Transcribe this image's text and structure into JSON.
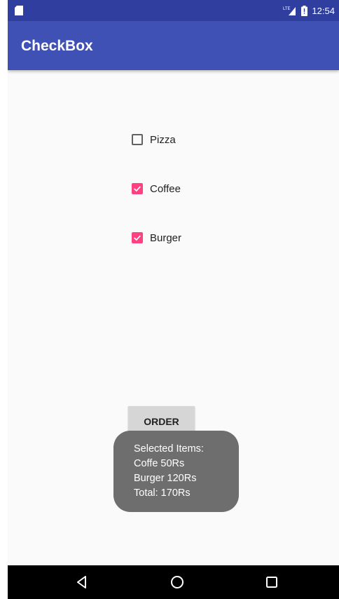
{
  "status_bar": {
    "time": "12:54",
    "network": "LTE",
    "icons": [
      "sd-card-icon",
      "signal-icon",
      "battery-icon"
    ]
  },
  "app_bar": {
    "title": "CheckBox"
  },
  "checkboxes": [
    {
      "label": "Pizza",
      "checked": false
    },
    {
      "label": "Coffee",
      "checked": true
    },
    {
      "label": "Burger",
      "checked": true
    }
  ],
  "order_button": {
    "label": "ORDER"
  },
  "toast": {
    "lines": [
      "Selected Items:",
      "Coffe 50Rs",
      "Burger 120Rs",
      "Total: 170Rs"
    ]
  },
  "nav_bar": {
    "icons": [
      "back-icon",
      "home-icon",
      "recents-icon"
    ]
  },
  "colors": {
    "primary": "#3f51b5",
    "primary_dark": "#303f9f",
    "accent": "#ff4081",
    "toast_bg": "#6e6e6e"
  }
}
